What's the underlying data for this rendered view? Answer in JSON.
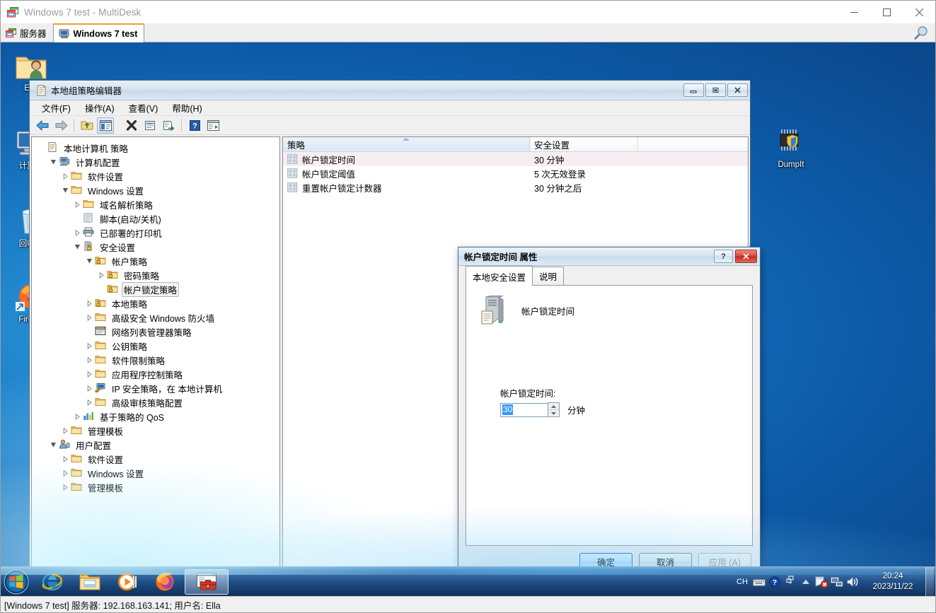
{
  "multidesk": {
    "title": "Windows 7 test - MultiDesk",
    "window_controls": {
      "minimize": "—",
      "maximize": "☐",
      "close": "✕"
    },
    "tabs": [
      {
        "label": "服务器",
        "icon": "multidesk-icon",
        "active": false
      },
      {
        "label": "Windows 7 test",
        "icon": "computer-icon",
        "active": true
      }
    ],
    "status": "[Windows 7 test] 服务器: 192.168.163.141; 用户名: Ella"
  },
  "desktop": {
    "icons": [
      {
        "label": "Ella",
        "icon": "user-folder-icon"
      },
      {
        "label": "计算机",
        "icon": "computer-icon"
      },
      {
        "label": "回收站",
        "icon": "recycle-bin-icon"
      },
      {
        "label": "Firefox",
        "icon": "firefox-icon"
      },
      {
        "label": "DumpIt",
        "icon": "dumpit-icon"
      }
    ]
  },
  "gpedit": {
    "title": "本地组策略编辑器",
    "window_controls": {
      "minimize": "minimize-icon",
      "maximize": "maximize-icon",
      "close": "close-icon"
    },
    "menus": [
      "文件(F)",
      "操作(A)",
      "查看(V)",
      "帮助(H)"
    ],
    "toolbar": [
      "back-arrow-icon",
      "forward-arrow-icon",
      "separator",
      "up-folder-icon",
      "show-tree-icon",
      "separator-none",
      "delete-icon",
      "properties-icon",
      "export-list-icon",
      "separator2",
      "help-icon",
      "view-icon"
    ],
    "tree": [
      {
        "label": "本地计算机 策略",
        "indent": 0,
        "twist": "none",
        "icon": "policy-icon"
      },
      {
        "label": "计算机配置",
        "indent": 1,
        "twist": "open",
        "icon": "computer-config-icon"
      },
      {
        "label": "软件设置",
        "indent": 2,
        "twist": "closed",
        "icon": "folder-icon"
      },
      {
        "label": "Windows 设置",
        "indent": 2,
        "twist": "open",
        "icon": "folder-icon"
      },
      {
        "label": "域名解析策略",
        "indent": 3,
        "twist": "closed",
        "icon": "folder-icon"
      },
      {
        "label": "脚本(启动/关机)",
        "indent": 3,
        "twist": "none",
        "icon": "script-icon"
      },
      {
        "label": "已部署的打印机",
        "indent": 3,
        "twist": "closed",
        "icon": "printer-icon"
      },
      {
        "label": "安全设置",
        "indent": 3,
        "twist": "open",
        "icon": "security-icon"
      },
      {
        "label": "帐户策略",
        "indent": 4,
        "twist": "open",
        "icon": "lock-folder-icon"
      },
      {
        "label": "密码策略",
        "indent": 5,
        "twist": "closed",
        "icon": "lock-folder-icon"
      },
      {
        "label": "帐户锁定策略",
        "indent": 5,
        "twist": "none",
        "icon": "lock-folder-icon",
        "selected": true
      },
      {
        "label": "本地策略",
        "indent": 4,
        "twist": "closed",
        "icon": "lock-folder-icon"
      },
      {
        "label": "高级安全 Windows 防火墙",
        "indent": 4,
        "twist": "closed",
        "icon": "folder-icon"
      },
      {
        "label": "网络列表管理器策略",
        "indent": 4,
        "twist": "none",
        "icon": "network-list-icon"
      },
      {
        "label": "公钥策略",
        "indent": 4,
        "twist": "closed",
        "icon": "folder-icon"
      },
      {
        "label": "软件限制策略",
        "indent": 4,
        "twist": "closed",
        "icon": "folder-icon"
      },
      {
        "label": "应用程序控制策略",
        "indent": 4,
        "twist": "closed",
        "icon": "folder-icon"
      },
      {
        "label": "IP 安全策略，在 本地计算机",
        "indent": 4,
        "twist": "closed",
        "icon": "ipsec-icon"
      },
      {
        "label": "高级审核策略配置",
        "indent": 4,
        "twist": "closed",
        "icon": "folder-icon"
      },
      {
        "label": "基于策略的 QoS",
        "indent": 3,
        "twist": "closed",
        "icon": "qos-icon"
      },
      {
        "label": "管理模板",
        "indent": 2,
        "twist": "closed",
        "icon": "folder-icon"
      },
      {
        "label": "用户配置",
        "indent": 1,
        "twist": "open",
        "icon": "user-config-icon"
      },
      {
        "label": "软件设置",
        "indent": 2,
        "twist": "closed",
        "icon": "folder-icon"
      },
      {
        "label": "Windows 设置",
        "indent": 2,
        "twist": "closed",
        "icon": "folder-icon"
      },
      {
        "label": "管理模板",
        "indent": 2,
        "twist": "closed",
        "icon": "folder-icon"
      }
    ],
    "list": {
      "columns": [
        "策略",
        "安全设置",
        ""
      ],
      "sorted_column": 0,
      "rows": [
        {
          "policy": "帐户锁定时间",
          "setting": "30 分钟",
          "selected": true
        },
        {
          "policy": "帐户锁定阈值",
          "setting": "5 次无效登录",
          "selected": false
        },
        {
          "policy": "重置帐户锁定计数器",
          "setting": "30 分钟之后",
          "selected": false
        }
      ]
    }
  },
  "properties_dialog": {
    "title": "帐户锁定时间 属性",
    "help_button": "?",
    "close_button": "✕",
    "tabs": [
      {
        "label": "本地安全设置",
        "active": true
      },
      {
        "label": "说明",
        "active": false
      }
    ],
    "heading": "帐户锁定时间",
    "field_label": "帐户锁定时间:",
    "field_value": "30",
    "field_unit": "分钟",
    "buttons": [
      {
        "label": "确定",
        "state": "default"
      },
      {
        "label": "取消",
        "state": "normal"
      },
      {
        "label": "应用 (A)",
        "state": "disabled"
      }
    ]
  },
  "taskbar": {
    "start": "start-orb-icon",
    "items": [
      {
        "icon": "internet-explorer-icon",
        "active": false
      },
      {
        "icon": "explorer-folder-icon",
        "active": false
      },
      {
        "icon": "media-player-icon",
        "active": false
      },
      {
        "icon": "firefox-icon",
        "active": false
      },
      {
        "icon": "mmc-console-icon",
        "active": true
      }
    ],
    "tray": {
      "ime": "CH",
      "icons": [
        "keyboard-icon",
        "help-icon",
        "network-flyout-icon",
        "show-hidden-icon",
        "action-center-icon",
        "network-icon",
        "volume-icon"
      ],
      "time": "20:24",
      "date": "2023/11/22"
    }
  }
}
